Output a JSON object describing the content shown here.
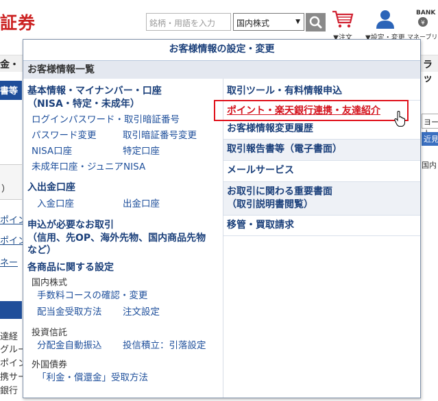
{
  "header": {
    "logo_text": "証券",
    "search_placeholder": "銘柄・用語を入力",
    "market_select_value": "国内株式",
    "cart_label": "▼注文",
    "account_label": "▼設定・変更",
    "bank_label_top": "BANK",
    "bank_label_bottom": "マネーブリッジ"
  },
  "background": {
    "bar_left": "金・",
    "bar_right": "ラッ",
    "blue_tab": "書等",
    "paren": "）",
    "links": [
      "ポイン",
      "ポイン",
      "ネー"
    ],
    "texts": [
      "達経",
      "グルー",
      "ポイン",
      "携サー",
      "銀行"
    ],
    "right_field": "ヨート",
    "right_btn": "近見方",
    "right_txt": "国内"
  },
  "panel": {
    "title": "お客様情報の設定・変更",
    "section": "お客様情報一覧",
    "left": {
      "basic_heading": "基本情報・マイナンバー・口座",
      "basic_heading2": "（NISA・特定・未成年）",
      "login_pw": "ログインパスワード・取引暗証番号",
      "pw_change": "パスワード変更",
      "pin_change": "取引暗証番号変更",
      "nisa": "NISA口座",
      "tokutei": "特定口座",
      "junior": "未成年口座・ジュニアNISA",
      "deposit_heading": "入出金口座",
      "deposit_in": "入金口座",
      "deposit_out": "出金口座",
      "apply_heading": "申込が必要なお取引",
      "apply_heading2": "（信用、先OP、海外先物、国内商品先物",
      "apply_heading3": "など）",
      "product_heading": "各商品に関する設定",
      "domestic_stock": "国内株式",
      "fee_course": "手数料コースの確認・変更",
      "dividend": "配当金受取方法",
      "order_setting": "注文設定",
      "fund": "投資信託",
      "auto_reinvest": "分配金自動振込",
      "accumulate": "投信積立：引落設定",
      "foreign_bond": "外国債券",
      "interest": "「利金・償還金」受取方法"
    },
    "right": {
      "tools": "取引ツール・有料情報申込",
      "point_rakuten": "ポイント・楽天銀行連携・友達紹介",
      "history": "お客様情報変更履歴",
      "reports": "取引報告書等（電子書面）",
      "mail": "メールサービス",
      "important_docs": "お取引に関わる重要書面",
      "important_docs2": "（取引説明書閲覧）",
      "transfer": "移管・買取請求"
    }
  }
}
